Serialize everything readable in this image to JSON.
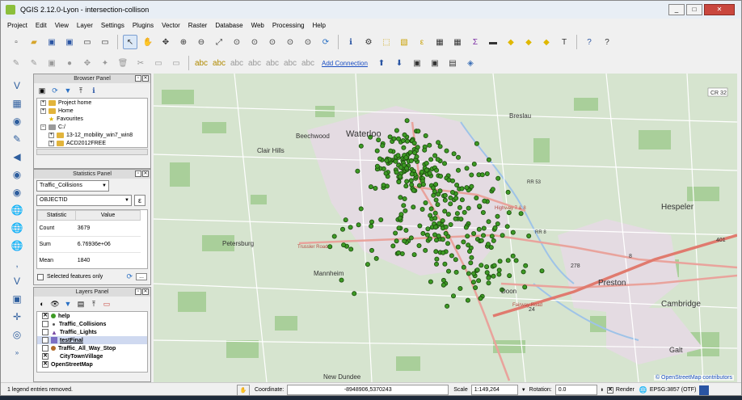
{
  "window": {
    "title": "QGIS 2.12.0-Lyon - intersection-collison",
    "controls": [
      "_",
      "□",
      "✕"
    ]
  },
  "menu": [
    "Project",
    "Edit",
    "View",
    "Layer",
    "Settings",
    "Plugins",
    "Vector",
    "Raster",
    "Database",
    "Web",
    "Processing",
    "Help"
  ],
  "toolbar2": {
    "add_connection": "Add Connection"
  },
  "browser_panel": {
    "title": "Browser Panel",
    "items": [
      {
        "label": "Project home",
        "type": "folder"
      },
      {
        "label": "Home",
        "type": "folder"
      },
      {
        "label": "Favourites",
        "type": "star"
      },
      {
        "label": "C:/",
        "type": "drive"
      },
      {
        "label": "13-12_mobility_win7_win8",
        "type": "folder"
      },
      {
        "label": "ACD2012FREE",
        "type": "folder"
      }
    ]
  },
  "statistics_panel": {
    "title": "Statistics Panel",
    "layer": "Traffic_Collisions",
    "field": "OBJECTID",
    "headers": [
      "Statistic",
      "Value"
    ],
    "rows": [
      [
        "Count",
        "3679"
      ],
      [
        "Sum",
        "6.76936e+06"
      ],
      [
        "Mean",
        "1840"
      ]
    ],
    "selected_only_label": "Selected features only",
    "more_button": "..."
  },
  "layers_panel": {
    "title": "Layers Panel",
    "layers": [
      {
        "label": "help",
        "checked": true,
        "symbol": "green-dot"
      },
      {
        "label": "Traffic_Collisions",
        "checked": false,
        "symbol": "small-dot"
      },
      {
        "label": "Traffic_Lights",
        "checked": false,
        "symbol": "triangle"
      },
      {
        "label": "testFinal",
        "checked": false,
        "symbol": "square"
      },
      {
        "label": "Traffic_All_Way_Stop",
        "checked": false,
        "symbol": "brown-dot"
      },
      {
        "label": "CityTownVillage",
        "checked": true,
        "symbol": "none"
      },
      {
        "label": "OpenStreetMap",
        "checked": true,
        "symbol": "none"
      }
    ]
  },
  "map": {
    "places": [
      "Waterloo",
      "Beechwood",
      "Clair Hills",
      "Petersburg",
      "Mannheim",
      "New Dundee",
      "Hespeler",
      "Preston",
      "Cambridge",
      "Galt",
      "Breslau",
      "Doon"
    ],
    "roads": [
      "Trussler Road",
      "Highway 7 & 8",
      "RR 53",
      "RR 8",
      "Fairway Road"
    ],
    "shields": [
      "CR 32",
      "401",
      "278",
      "24",
      "8"
    ],
    "attribution": "© OpenStreetMap contributors"
  },
  "status": {
    "message": "1 legend entries removed.",
    "coordinate_label": "Coordinate:",
    "coordinate": "-8948906,5370243",
    "scale_label": "Scale",
    "scale": "1:149,264",
    "rotation_label": "Rotation:",
    "rotation": "0.0",
    "render_label": "Render",
    "crs": "EPSG:3857 (OTF)"
  },
  "colors": {
    "point": "#3d9a24",
    "point_stroke": "#1b4a0e",
    "map_bg": "#d9e6d2",
    "urban": "#e6dfe6",
    "road_major": "#e9a39c",
    "road_minor": "#ffffff",
    "link": "#1a4ec2"
  }
}
